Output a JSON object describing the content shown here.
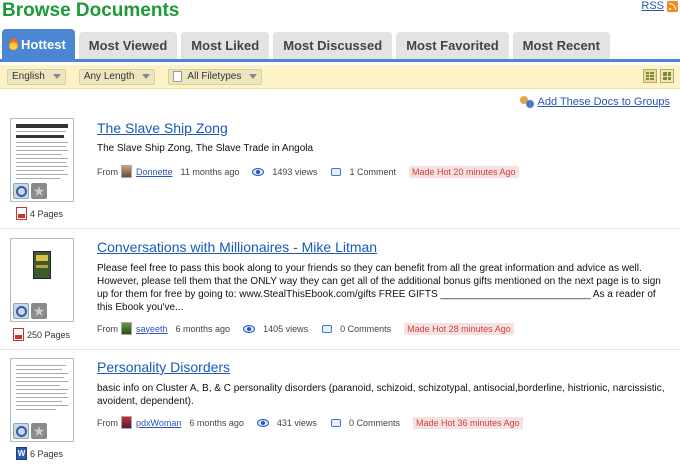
{
  "header": {
    "title": "Browse Documents",
    "rss_label": "RSS"
  },
  "tabs": [
    {
      "label": "Hottest",
      "active": true,
      "icon": "flame-icon"
    },
    {
      "label": "Most Viewed",
      "active": false
    },
    {
      "label": "Most Liked",
      "active": false
    },
    {
      "label": "Most Discussed",
      "active": false
    },
    {
      "label": "Most Favorited",
      "active": false
    },
    {
      "label": "Most Recent",
      "active": false
    }
  ],
  "filters": {
    "language": "English",
    "length": "Any Length",
    "filetype": "All Filetypes"
  },
  "actions": {
    "add_to_groups": "Add These Docs to Groups"
  },
  "documents": [
    {
      "title": "The Slave Ship Zong",
      "description": "The Slave Ship Zong, The Slave Trade in Angola",
      "pages": "4 Pages",
      "file_icon": "pdf-icon",
      "from_label": "From",
      "author": "Donnette",
      "age": "11 months ago",
      "views": "1493 views",
      "comments": "1 Comment",
      "hot": "Made Hot 20 minutes Ago"
    },
    {
      "title": "Conversations with Millionaires - Mike Litman",
      "description": "Please feel free to pass this book along to your friends so they can benefit from all the great information and advice as well. However, please tell them that the ONLY way they can get all of the additional bonus gifts mentioned on the next page is to sign up for them for free by going to: www.StealThisEbook.com/gifts FREE GIFTS ___________________________ As a reader of this Ebook you've...",
      "pages": "250 Pages",
      "file_icon": "pdf-icon",
      "from_label": "From",
      "author": "sayeeth",
      "age": "6 months ago",
      "views": "1405 views",
      "comments": "0 Comments",
      "hot": "Made Hot 28 minutes Ago"
    },
    {
      "title": "Personality Disorders",
      "description": "basic info on Cluster A, B, & C personality disorders (paranoid, schizoid, schizotypal, antisocial,borderline, histrionic, narcissistic, avoident, dependent).",
      "pages": "6 Pages",
      "file_icon": "word-icon",
      "from_label": "From",
      "author": "pdxWoman",
      "age": "6 months ago",
      "views": "431 views",
      "comments": "0 Comments",
      "hot": "Made Hot 36 minutes Ago"
    }
  ],
  "colors": {
    "title_green": "#1d9a38",
    "tab_active": "#4a86d2",
    "link_blue": "#1a5ab8",
    "hot_red": "#d0433a",
    "filter_bar": "#fdf3c6"
  }
}
